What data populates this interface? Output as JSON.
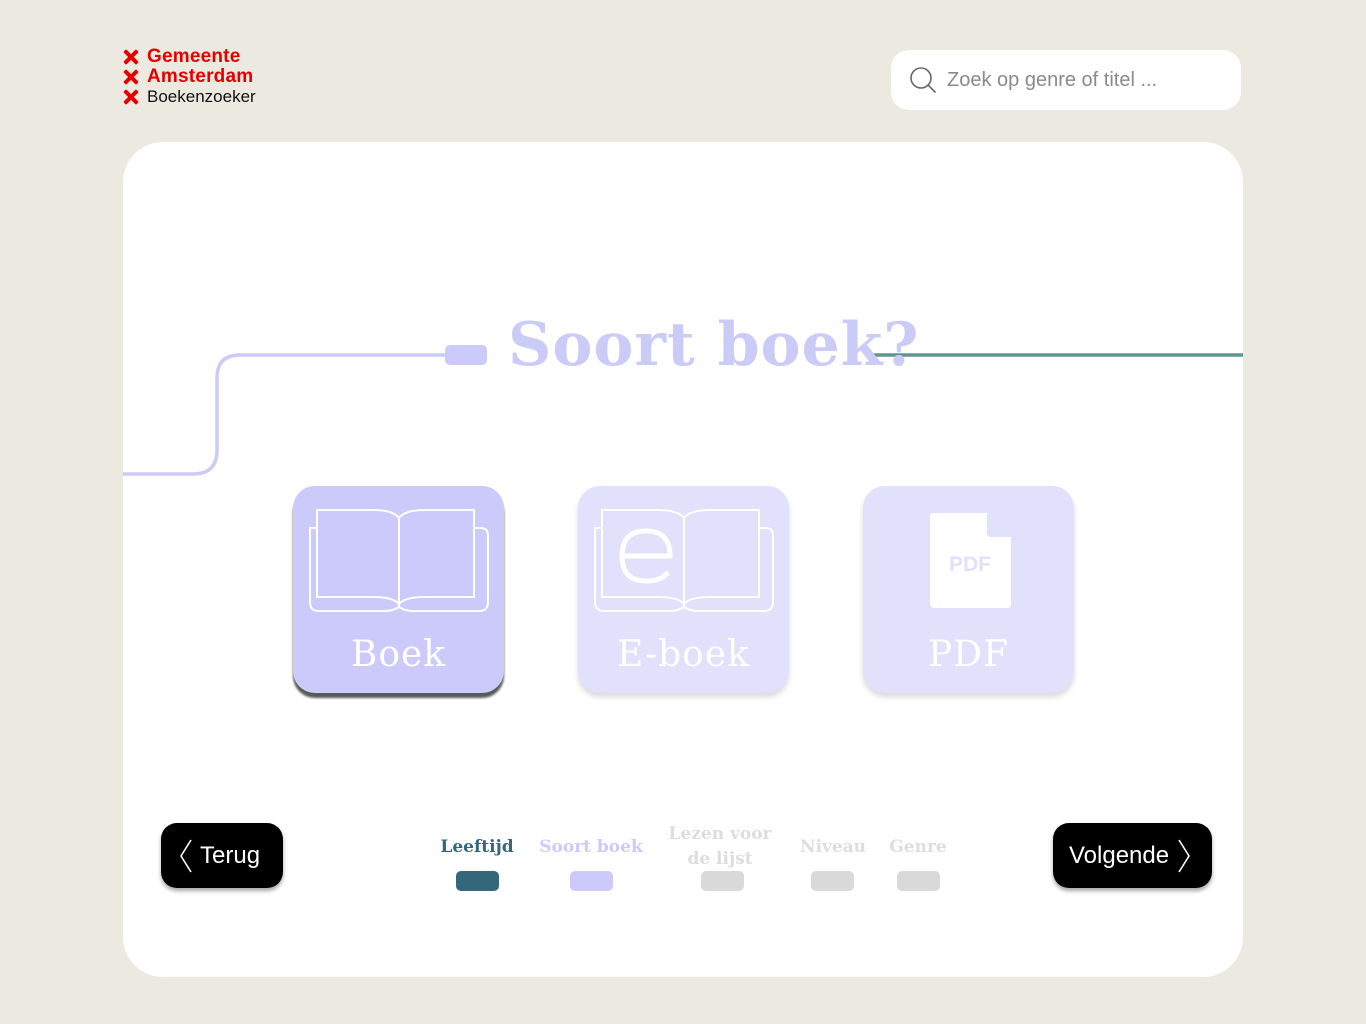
{
  "logo": {
    "line1": "Gemeente",
    "line2": "Amsterdam",
    "line3": "Boekenzoeker"
  },
  "search": {
    "placeholder": "Zoek op genre of titel ...",
    "icon": "search-icon"
  },
  "question": {
    "title": "Soort boek?"
  },
  "options": [
    {
      "label": "Boek",
      "icon": "book-icon",
      "selected": true
    },
    {
      "label": "E-boek",
      "icon": "ebook-icon",
      "selected": false
    },
    {
      "label": "PDF",
      "icon": "pdf-file-icon",
      "icon_text": "PDF",
      "selected": false
    }
  ],
  "navigation": {
    "back_label": "Terug",
    "next_label": "Volgende"
  },
  "steps": [
    {
      "label": "Leeftijd",
      "state": "done"
    },
    {
      "label": "Soort boek",
      "state": "current"
    },
    {
      "label_line1": "Lezen voor",
      "label_line2": "de lijst",
      "state": "upcoming"
    },
    {
      "label": "Niveau",
      "state": "upcoming"
    },
    {
      "label": "Genre",
      "state": "upcoming"
    }
  ],
  "colors": {
    "background": "#ECE9E1",
    "brand_red": "#E50000",
    "lavender": "#CBCAFA",
    "lavender_light": "#E1E1FB",
    "teal": "#33677A",
    "track_teal": "#5E9590",
    "inactive_gray": "#D9D9D9"
  }
}
